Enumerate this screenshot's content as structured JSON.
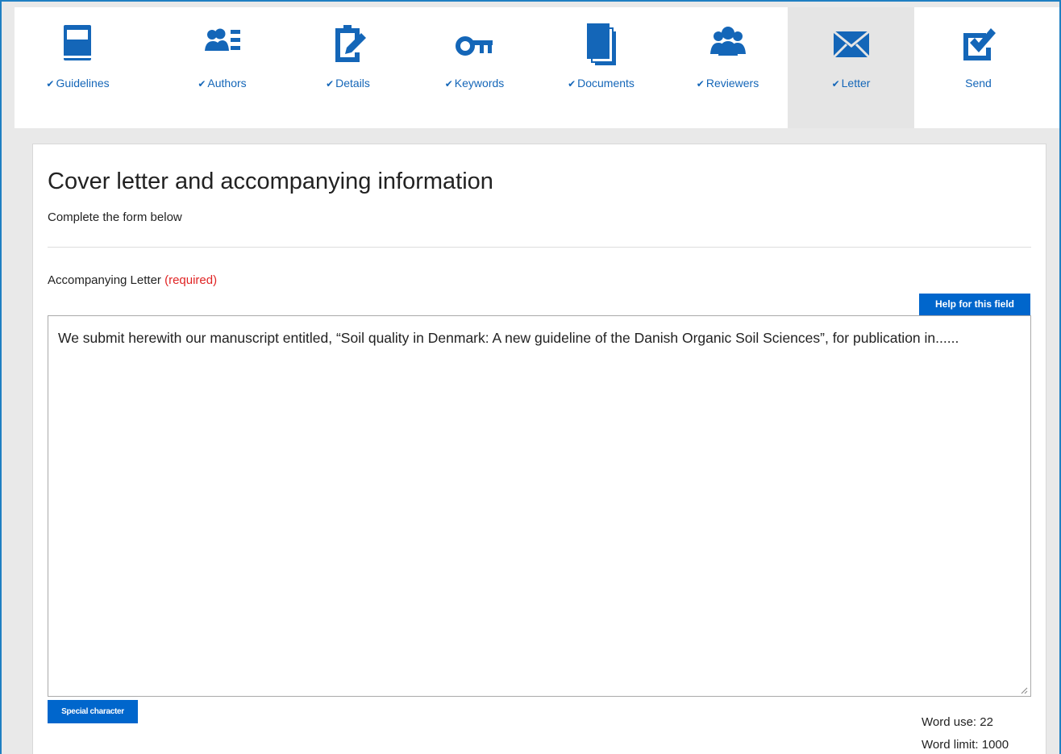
{
  "steps": [
    {
      "label": "Guidelines",
      "checked": "✔",
      "icon": "book-icon",
      "active": false
    },
    {
      "label": "Authors",
      "checked": "✔",
      "icon": "authors-list-icon",
      "active": false
    },
    {
      "label": "Details",
      "checked": "✔",
      "icon": "clipboard-edit-icon",
      "active": false
    },
    {
      "label": "Keywords",
      "checked": "✔",
      "icon": "key-icon",
      "active": false
    },
    {
      "label": "Documents",
      "checked": "✔",
      "icon": "documents-icon",
      "active": false
    },
    {
      "label": "Reviewers",
      "checked": "✔",
      "icon": "users-group-icon",
      "active": false
    },
    {
      "label": "Letter",
      "checked": "✔",
      "icon": "envelope-icon",
      "active": true
    },
    {
      "label": "Send",
      "checked": "",
      "icon": "checkbox-check-icon",
      "active": false
    }
  ],
  "page": {
    "title": "Cover letter and accompanying information",
    "subtitle": "Complete the form below"
  },
  "letter_field": {
    "label": "Accompanying Letter ",
    "required": "(required)",
    "help_label": "Help for this field",
    "value": "We submit herewith our manuscript entitled, “Soil quality in Denmark: A new guideline of the Danish Organic Soil Sciences”, for publication in......",
    "special_character_label": "Special character"
  },
  "word_count": {
    "use": "Word use: 22",
    "limit": "Word limit: 1000"
  },
  "colors": {
    "accent": "#0066cc",
    "icon": "#1466b8",
    "required": "#e02424",
    "frame_border": "#1f7fc2",
    "active_step_bg": "#e5e5e5"
  }
}
